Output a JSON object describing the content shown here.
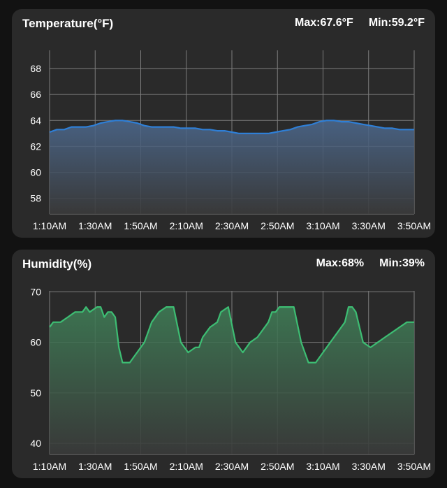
{
  "temperature": {
    "title": "Temperature(°F)",
    "max_label": "Max:67.6°F",
    "min_label": "Min:59.2°F"
  },
  "humidity": {
    "title": "Humidity(%)",
    "max_label": "Max:68%",
    "min_label": "Min:39%"
  },
  "colors": {
    "temperature_line": "#2f7fd6",
    "humidity_line": "#3dbd73",
    "grid": "#8a8a8a",
    "card_bg": "#2a2a2a",
    "page_bg": "#121212"
  },
  "chart_data": [
    {
      "type": "area",
      "title": "Temperature(°F)",
      "x_tick_labels": [
        "1:10AM",
        "1:30AM",
        "1:50AM",
        "2:10AM",
        "2:30AM",
        "2:50AM",
        "3:10AM",
        "3:30AM",
        "3:50AM"
      ],
      "y_ticks": [
        58,
        60,
        62,
        64,
        66,
        68
      ],
      "xlim": [
        0,
        1
      ],
      "ylim": [
        56.8,
        69.4
      ],
      "grid": true,
      "series": [
        {
          "x": [
            0.0,
            0.02,
            0.04,
            0.06,
            0.08,
            0.1,
            0.12,
            0.14,
            0.16,
            0.18,
            0.2,
            0.22,
            0.24,
            0.26,
            0.28,
            0.3,
            0.32,
            0.34,
            0.36,
            0.38,
            0.4,
            0.42,
            0.44,
            0.46,
            0.48,
            0.5,
            0.52,
            0.54,
            0.56,
            0.58,
            0.6,
            0.62,
            0.64,
            0.66,
            0.68,
            0.7,
            0.72,
            0.74,
            0.76,
            0.78,
            0.8,
            0.82,
            0.84,
            0.86,
            0.88,
            0.9,
            0.92,
            0.94,
            0.96,
            0.98,
            1.0
          ],
          "y": [
            63.1,
            63.3,
            63.3,
            63.5,
            63.5,
            63.5,
            63.6,
            63.8,
            63.9,
            64.0,
            64.0,
            63.9,
            63.8,
            63.6,
            63.5,
            63.5,
            63.5,
            63.5,
            63.4,
            63.4,
            63.4,
            63.3,
            63.3,
            63.2,
            63.2,
            63.1,
            63.0,
            63.0,
            63.0,
            63.0,
            63.0,
            63.1,
            63.2,
            63.3,
            63.5,
            63.6,
            63.7,
            63.9,
            64.0,
            64.0,
            63.9,
            63.9,
            63.8,
            63.7,
            63.6,
            63.5,
            63.4,
            63.4,
            63.3,
            63.3,
            63.3
          ]
        }
      ]
    },
    {
      "type": "area",
      "title": "Humidity(%)",
      "x_tick_labels": [
        "1:10AM",
        "1:30AM",
        "1:50AM",
        "2:10AM",
        "2:30AM",
        "2:50AM",
        "3:10AM",
        "3:30AM",
        "3:50AM"
      ],
      "y_ticks": [
        40,
        50,
        60,
        70
      ],
      "xlim": [
        0,
        1
      ],
      "ylim": [
        37.8,
        70.2
      ],
      "grid": true,
      "series": [
        {
          "x": [
            0.0,
            0.01,
            0.03,
            0.05,
            0.07,
            0.09,
            0.1,
            0.11,
            0.13,
            0.14,
            0.15,
            0.16,
            0.17,
            0.18,
            0.19,
            0.2,
            0.22,
            0.24,
            0.26,
            0.28,
            0.3,
            0.32,
            0.34,
            0.36,
            0.38,
            0.4,
            0.41,
            0.42,
            0.43,
            0.44,
            0.46,
            0.47,
            0.49,
            0.51,
            0.53,
            0.55,
            0.57,
            0.59,
            0.6,
            0.61,
            0.62,
            0.63,
            0.64,
            0.65,
            0.67,
            0.69,
            0.71,
            0.73,
            0.75,
            0.77,
            0.78,
            0.79,
            0.8,
            0.81,
            0.82,
            0.83,
            0.84,
            0.86,
            0.88,
            0.9,
            0.92,
            0.94,
            0.96,
            0.98,
            1.0
          ],
          "y": [
            63,
            64,
            64,
            65,
            66,
            66,
            67,
            66,
            67,
            67,
            65,
            66,
            66,
            65,
            59,
            56,
            56,
            58,
            60,
            64,
            66,
            67,
            67,
            60,
            58,
            59,
            59,
            61,
            62,
            63,
            64,
            66,
            67,
            60,
            58,
            60,
            61,
            63,
            64,
            66,
            66,
            67,
            67,
            67,
            67,
            60,
            56,
            56,
            58,
            60,
            61,
            62,
            63,
            64,
            67,
            67,
            66,
            60,
            59,
            60,
            61,
            62,
            63,
            64,
            64
          ]
        }
      ]
    }
  ]
}
